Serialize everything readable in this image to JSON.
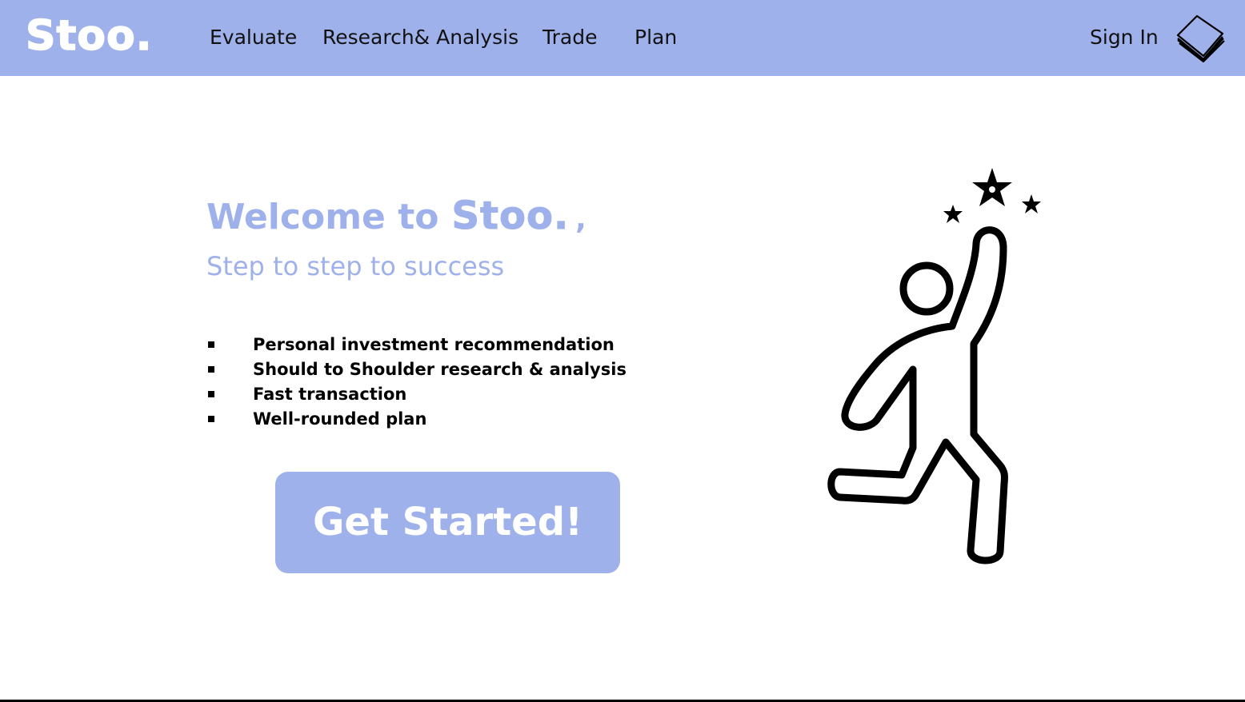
{
  "header": {
    "logo": "Stoo.",
    "nav": [
      {
        "label": "Evaluate"
      },
      {
        "label": "Research& Analysis"
      },
      {
        "label": "Trade"
      },
      {
        "label": "Plan"
      }
    ],
    "sign_in": "Sign In",
    "menu_icon": "stacked-pages-icon"
  },
  "hero": {
    "welcome": "Welcome to",
    "brand": "Stoo.",
    "comma": ",",
    "tagline": "Step to step to success",
    "features": [
      "Personal investment recommendation",
      "Should to Shoulder research & analysis",
      "Fast transaction",
      "Well-rounded plan"
    ],
    "cta": "Get Started!",
    "illustration": "person-reaching-stars-icon"
  },
  "colors": {
    "accent": "#9fb1ea",
    "text": "#111111",
    "background": "#ffffff"
  }
}
